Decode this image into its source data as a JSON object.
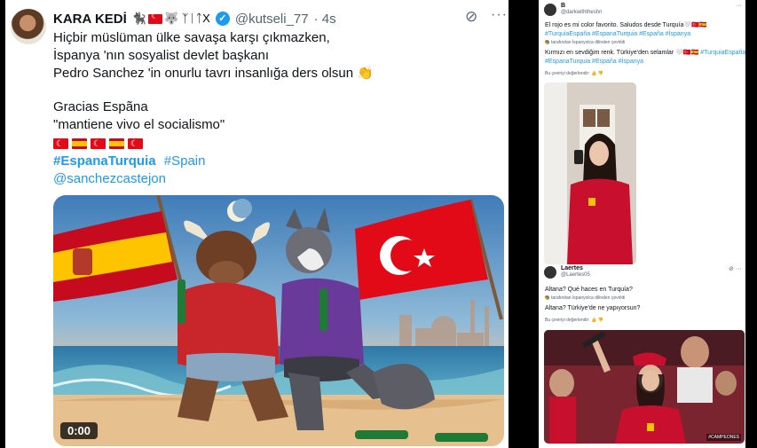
{
  "tweet": {
    "display_name": "KARA KEDİ",
    "name_emojis": "🐈‍⬛",
    "name_suffix": "🐺 ᛉᛁᛏX",
    "handle": "@kutseli_77",
    "time": "· 4s",
    "lines": [
      "Hiçbir müslüman ülke savaşa karşı çıkmazken,",
      "İspanya 'nın  sosyalist devlet başkanı",
      "Pedro Sanchez 'in onurlu tavrı insanlığa ders olsun 👏"
    ],
    "line2": [
      "Gracias Espãna",
      "\"mantiene vivo el socialismo\""
    ],
    "hashtag1": "#EspanaTurquia",
    "hashtag2": "#Spain",
    "mention": "@sanchezcastejon",
    "video_time": "0:00",
    "icons": [
      "grok-icon",
      "more-icon",
      "verified-icon"
    ]
  },
  "replies": [
    {
      "name": "B",
      "handle": "@darkwiththeshn",
      "text1": "El rojo es mi color favorito. Saludos desde Turquía🤍🇹🇷🇪🇸",
      "tags1": "#TurquiaEspaña #EspanaTurquia #España #İspanya",
      "translated": "tarafından İspanyolca dilinden çevrildi",
      "text2": "Kırmızı en sevdiğim renk. Türkiye'den selamlar 🤍🇹🇷🇪🇸",
      "tags2_inline": "#TurquiaEspaña",
      "tags2": "#EspanaTurquia #España #İspanya",
      "rate": "Bu çeviriyi değerlendir:"
    },
    {
      "name": "Laertes",
      "handle": "@Laertes05",
      "text1": "Altana? Qué haces en Turquía?",
      "translated": "tarafından İspanyolca dilinden çevrildi",
      "text2": "Altana? Türkiye'de ne yapıyorsun?",
      "rate": "Bu çeviriyi değerlendir:",
      "photo_caption": "#CAMPEONES"
    }
  ],
  "colors": {
    "link": "#1d9bf0",
    "text": "#0f1419",
    "muted": "#536471"
  }
}
